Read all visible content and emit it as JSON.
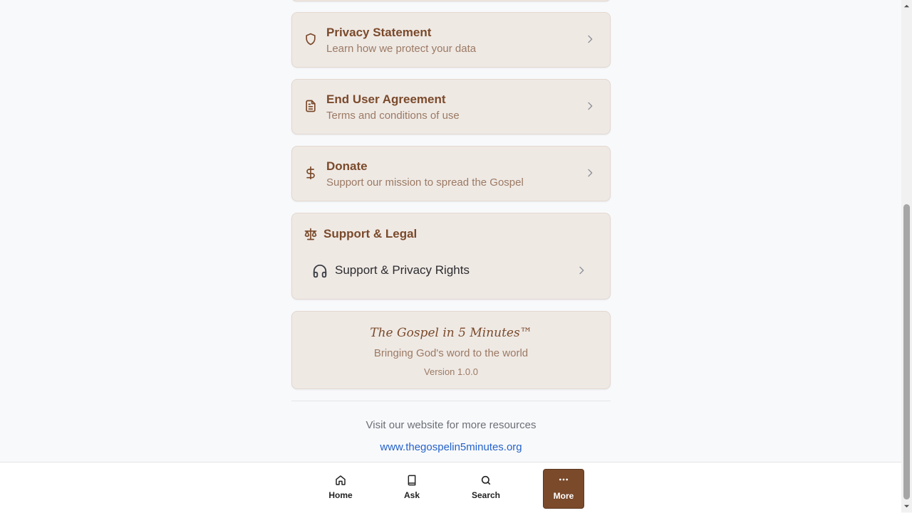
{
  "items": [
    {
      "title": "Privacy Statement",
      "subtitle": "Learn how we protect your data",
      "icon": "shield-icon"
    },
    {
      "title": "End User Agreement",
      "subtitle": "Terms and conditions of use",
      "icon": "document-icon"
    },
    {
      "title": "Donate",
      "subtitle": "Support our mission to spread the Gospel",
      "icon": "dollar-icon"
    }
  ],
  "support": {
    "title": "Support & Legal",
    "icon": "scale-icon",
    "row": {
      "label": "Support & Privacy Rights",
      "icon": "headphones-icon"
    }
  },
  "about": {
    "brand": "The Gospel in 5 Minutes™",
    "tagline": "Bringing God's word to the world",
    "version": "Version 1.0.0"
  },
  "footer": {
    "visit_text": "Visit our website for more resources",
    "website": "www.thegospelin5minutes.org"
  },
  "bottom_nav": {
    "tabs": [
      {
        "label": "Home",
        "icon": "home-icon"
      },
      {
        "label": "Ask",
        "icon": "book-icon"
      },
      {
        "label": "Search",
        "icon": "search-icon"
      },
      {
        "label": "More",
        "icon": "more-icon",
        "active": true
      }
    ]
  },
  "colors": {
    "accent": "#7a4a2b",
    "card": "#efe9e4",
    "link": "#2563c9"
  }
}
